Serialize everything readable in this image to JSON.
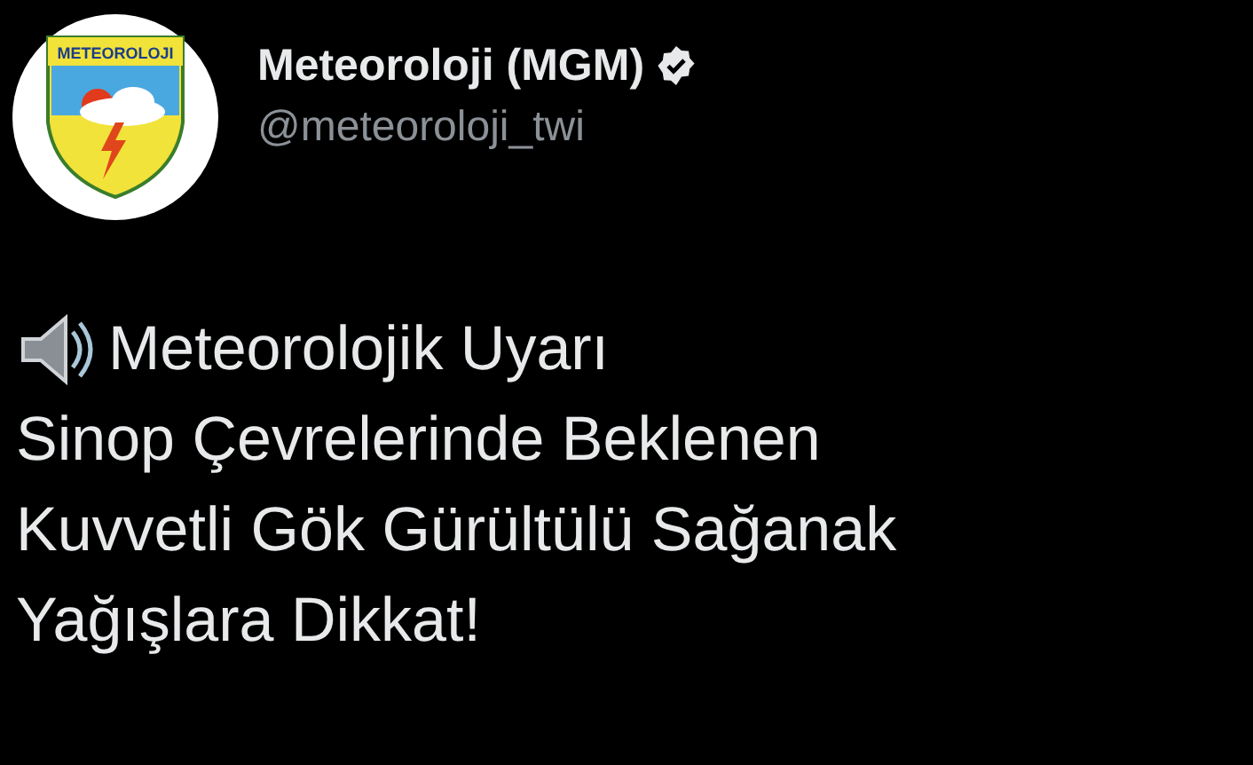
{
  "author": {
    "logo_text": "METEOROLOJI",
    "name": "Meteoroloji (MGM)",
    "verified": true,
    "handle": "@meteoroloji_twi"
  },
  "tweet": {
    "lines": [
      "Meteorolojik Uyarı",
      "Sinop Çevrelerinde Beklenen",
      "Kuvvetli Gök Gürültülü Sağanak",
      "Yağışlara Dikkat!"
    ]
  }
}
